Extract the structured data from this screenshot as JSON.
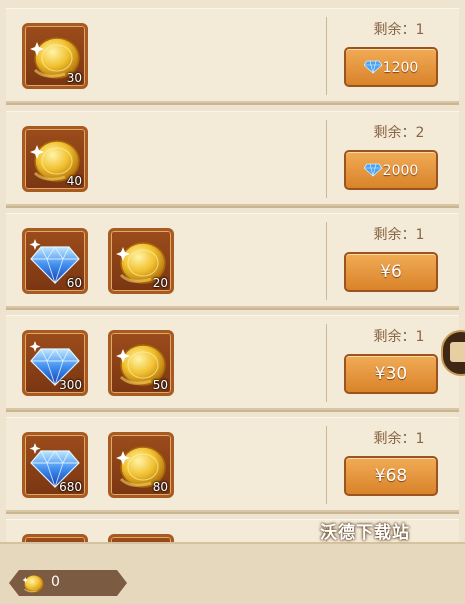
{
  "packs": [
    {
      "items": [
        {
          "type": "coin",
          "icon": "gold-moon-coin-icon",
          "qty": "30"
        }
      ],
      "remaining": "剩余：1",
      "price": {
        "currency": "gem",
        "text": "1200"
      }
    },
    {
      "items": [
        {
          "type": "coin",
          "icon": "gold-moon-coin-icon",
          "qty": "40"
        }
      ],
      "remaining": "剩余：2",
      "price": {
        "currency": "gem",
        "text": "2000"
      }
    },
    {
      "items": [
        {
          "type": "gem",
          "icon": "blue-diamond-icon",
          "qty": "60"
        },
        {
          "type": "coin",
          "icon": "gold-moon-coin-icon",
          "qty": "20"
        }
      ],
      "remaining": "剩余：1",
      "price": {
        "currency": "yuan",
        "text": "¥6"
      }
    },
    {
      "items": [
        {
          "type": "gem",
          "icon": "blue-diamond-icon",
          "qty": "300"
        },
        {
          "type": "coin",
          "icon": "gold-moon-coin-icon",
          "qty": "50"
        }
      ],
      "remaining": "剩余：1",
      "price": {
        "currency": "yuan",
        "text": "¥30"
      }
    },
    {
      "items": [
        {
          "type": "gem",
          "icon": "blue-diamond-icon",
          "qty": "680"
        },
        {
          "type": "coin",
          "icon": "gold-moon-coin-icon",
          "qty": "80"
        }
      ],
      "remaining": "剩余：1",
      "price": {
        "currency": "yuan",
        "text": "¥68"
      }
    }
  ],
  "footer": {
    "currency_icon": "gold-moon-coin-icon",
    "balance": "0"
  },
  "watermark": "沃德下载站",
  "colors": {
    "button": "#e4923a",
    "slot": "#8a4219",
    "background": "#efe4d0"
  }
}
